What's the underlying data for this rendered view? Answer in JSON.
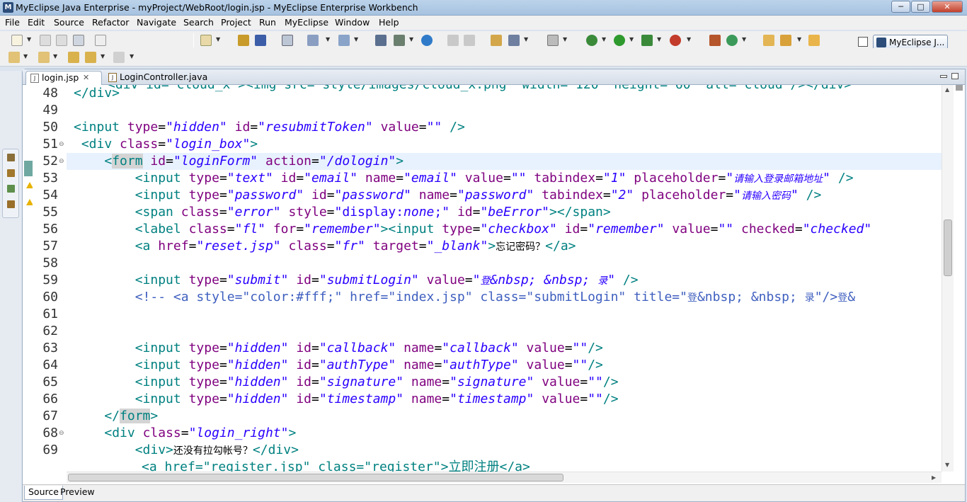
{
  "window": {
    "title": "MyEclipse Java Enterprise - myProject/WebRoot/login.jsp - MyEclipse Enterprise Workbench",
    "min": "─",
    "max": "□",
    "close": "✕"
  },
  "menu": [
    "File",
    "Edit",
    "Source",
    "Refactor",
    "Navigate",
    "Search",
    "Project",
    "Run",
    "MyEclipse",
    "Window",
    "Help"
  ],
  "perspective": {
    "label": "MyEclipse J..."
  },
  "tabs": [
    {
      "label": "login.jsp",
      "close": "✕"
    },
    {
      "label": "LoginController.java"
    }
  ],
  "bottom_tabs": [
    "Source",
    "Preview"
  ],
  "editor": {
    "line_numbers": [
      "48",
      "49",
      "50",
      "51",
      "52",
      "53",
      "54",
      "55",
      "56",
      "57",
      "58",
      "59",
      "60",
      "61",
      "62",
      "63",
      "64",
      "65",
      "66",
      "67",
      "68",
      "69"
    ],
    "partial_top": "<div id=\"cloud_x\"><img src=\"style/images/cloud_x.png\" width=\"120\" height=\"60\" alt=\"cloud\"/></div>",
    "partial_bottom": "<a href=\"register.jsp\" class=\"register\">立即注册</a>"
  },
  "colors": {
    "tag": "#008080",
    "attr": "#7f007f",
    "string": "#2a00ff",
    "comment": "#3f5fbf",
    "current_line": "#e8f2fe"
  }
}
